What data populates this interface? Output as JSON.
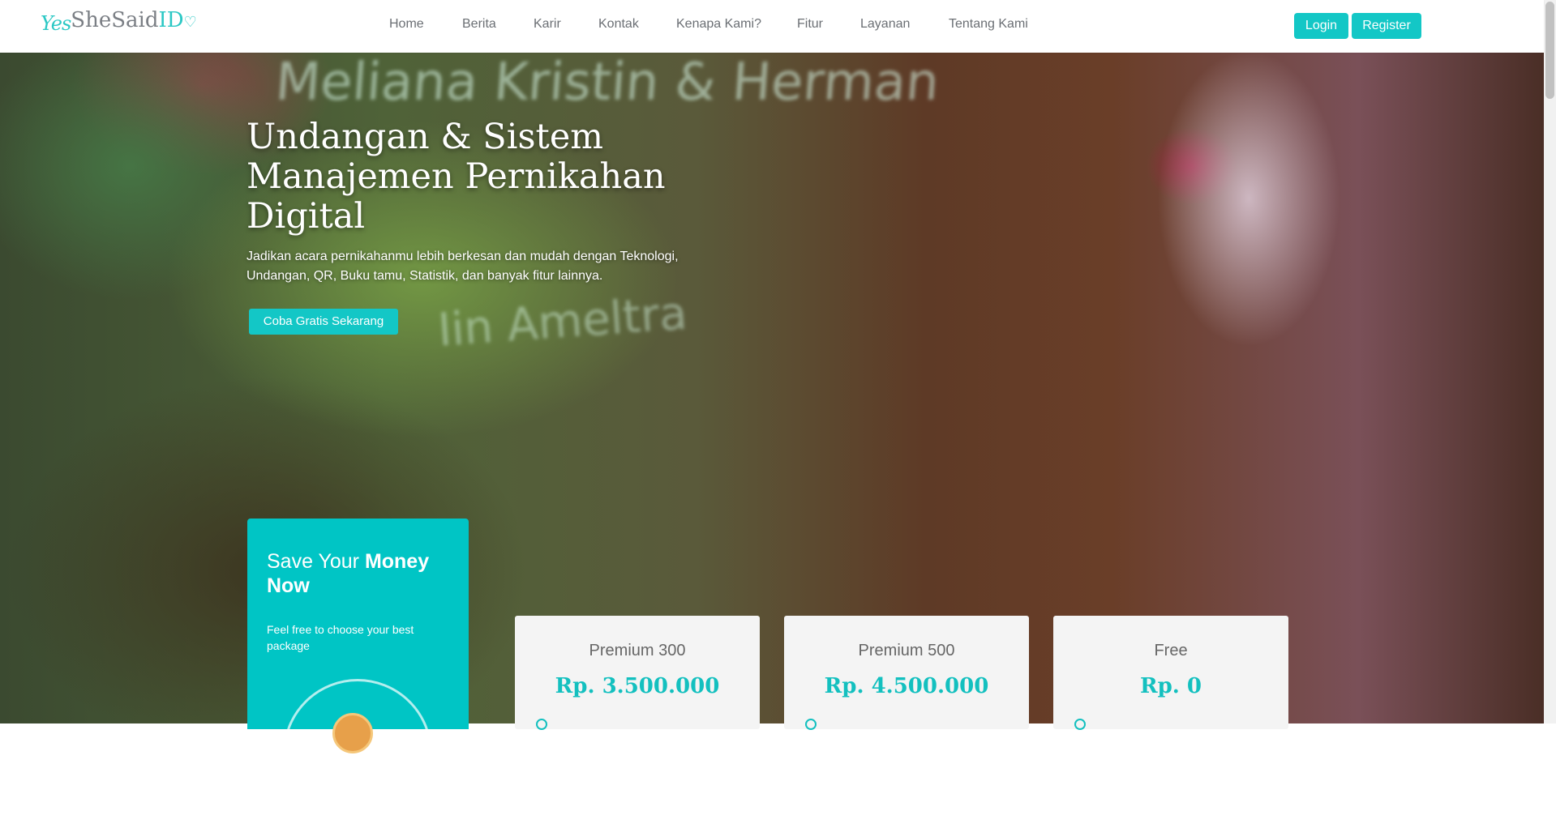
{
  "navbar": {
    "logo": {
      "yes": "Yes",
      "she_said": "SheSaid",
      "id": "ID",
      "heart": "♡"
    },
    "links": [
      "Home",
      "Berita",
      "Karir",
      "Kontak",
      "Kenapa Kami?",
      "Fitur",
      "Layanan",
      "Tentang Kami"
    ],
    "login_label": "Login",
    "register_label": "Register"
  },
  "hero": {
    "title": "Undangan & Sistem Manajemen Pernikahan Digital",
    "subtitle": "Jadikan acara pernikahanmu lebih berkesan dan mudah dengan Teknologi, Undangan, QR, Buku tamu, Statistik, dan banyak fitur lainnya.",
    "cta_label": "Coba Gratis Sekarang",
    "background_text_1": "Meliana Kristin & Herman",
    "background_text_2": "Iin Ameltra"
  },
  "pricing": {
    "intro": {
      "title_normal": "Save Your ",
      "title_bold": "Money Now",
      "description": "Feel free to choose your best package"
    },
    "plans": [
      {
        "name": "Premium 300",
        "price": "Rp. 3.500.000"
      },
      {
        "name": "Premium 500",
        "price": "Rp. 4.500.000"
      },
      {
        "name": "Free",
        "price": "Rp. 0"
      }
    ]
  },
  "colors": {
    "accent": "#13c7c6",
    "intro_card": "#00c5c5",
    "nav_text": "#6b6f74"
  }
}
